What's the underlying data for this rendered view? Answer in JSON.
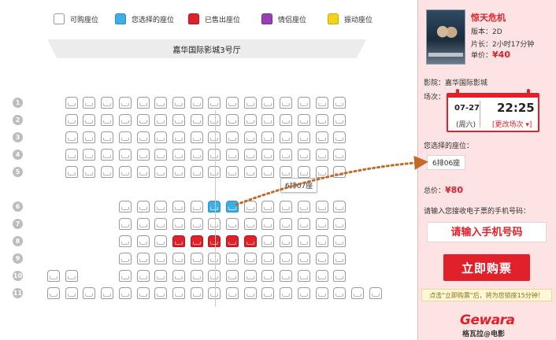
{
  "legend": {
    "available": "可购座位",
    "selected": "您选择的座位",
    "sold": "已售出座位",
    "couple": "情侣座位",
    "vibration": "振动座位"
  },
  "screen": {
    "hall_name": "嘉华国际影城3号厅"
  },
  "rows": [
    {
      "num": "1",
      "seats": "...............a"
    },
    {
      "num": "2"
    },
    {
      "num": "3"
    },
    {
      "num": "4"
    },
    {
      "num": "5"
    },
    {
      "num": "6"
    },
    {
      "num": "7"
    },
    {
      "num": "8"
    },
    {
      "num": "9"
    },
    {
      "num": "10"
    },
    {
      "num": "11"
    }
  ],
  "tooltip": "6排07座",
  "movie": {
    "title": "惊天危机",
    "version_label": "版本：",
    "version": "2D",
    "duration_label": "片长：",
    "duration": "2小时17分钟",
    "price_label": "单价：",
    "price": "¥40"
  },
  "cinema": {
    "label": "影院：",
    "name": "嘉华国际影城"
  },
  "showtime": {
    "label": "场次：",
    "date": "07-27",
    "weekday": "(周六)",
    "time": "22:25",
    "change": "[更改场次 ▾]"
  },
  "selection": {
    "label": "您选择的座位：",
    "seat": "6排06座"
  },
  "total": {
    "label": "总价：",
    "price": "¥80"
  },
  "phone": {
    "label": "请输入您接收电子票的手机号码：",
    "placeholder": "请输入手机号码"
  },
  "buy_button": "立即购票",
  "notice": "点击\"立即购票\"后，将为您锁座15分钟！",
  "logo": {
    "brand": "Gewara",
    "name": "格瓦拉@电影"
  },
  "colors": {
    "accent": "#e0212b",
    "selected": "#3eaee6",
    "sold": "#e0212b",
    "couple": "#9a3fb3",
    "vibration": "#f2d315",
    "panel_bg": "#fde3e3"
  }
}
